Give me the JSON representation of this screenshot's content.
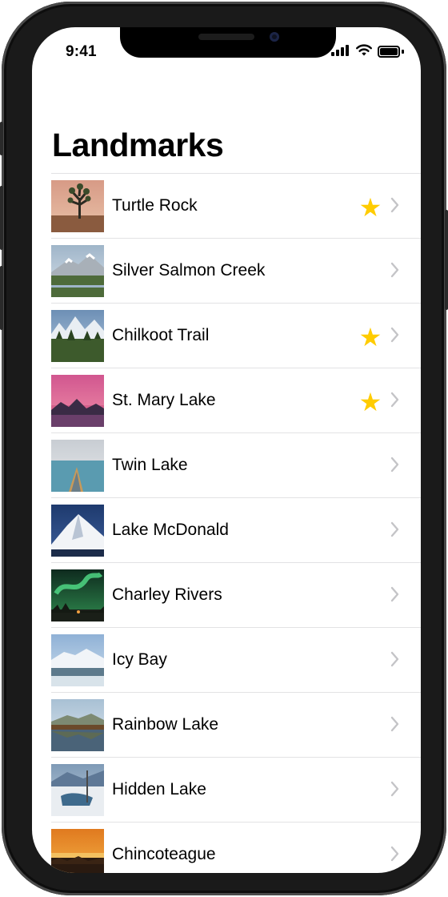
{
  "status_bar": {
    "time": "9:41"
  },
  "nav": {
    "title": "Landmarks"
  },
  "landmarks": [
    {
      "name": "Turtle Rock",
      "favorite": true,
      "thumb": {
        "sky": [
          "#d79a86",
          "#e9c2a8"
        ],
        "ground": "#8a5b3f",
        "feature": "tree"
      }
    },
    {
      "name": "Silver Salmon Creek",
      "favorite": false,
      "thumb": {
        "sky": [
          "#9fb5c9",
          "#d9e2ea"
        ],
        "ground": "#4e6b3a",
        "feature": "mountain"
      }
    },
    {
      "name": "Chilkoot Trail",
      "favorite": true,
      "thumb": {
        "sky": [
          "#6d8fb5",
          "#b5cbe0"
        ],
        "ground": "#3d5a2c",
        "feature": "peaks"
      }
    },
    {
      "name": "St. Mary Lake",
      "favorite": true,
      "thumb": {
        "sky": [
          "#d1568f",
          "#f08fa8"
        ],
        "ground": "#3a2b45",
        "feature": "sunset"
      }
    },
    {
      "name": "Twin Lake",
      "favorite": false,
      "thumb": {
        "sky": [
          "#c8cdd3",
          "#e8eaec"
        ],
        "ground": "#5a9bb0",
        "feature": "canoe"
      }
    },
    {
      "name": "Lake McDonald",
      "favorite": false,
      "thumb": {
        "sky": [
          "#1e3a6e",
          "#3d5e9a"
        ],
        "ground": "#f2f4f7",
        "feature": "snowpeak"
      }
    },
    {
      "name": "Charley Rivers",
      "favorite": false,
      "thumb": {
        "sky": [
          "#0e2a1e",
          "#2f8a4e"
        ],
        "ground": "#1a1f18",
        "feature": "aurora"
      }
    },
    {
      "name": "Icy Bay",
      "favorite": false,
      "thumb": {
        "sky": [
          "#8fb1d6",
          "#d2e1ef"
        ],
        "ground": "#5d7a8c",
        "feature": "glacier"
      }
    },
    {
      "name": "Rainbow Lake",
      "favorite": false,
      "thumb": {
        "sky": [
          "#a8c0d4",
          "#dfe8ef"
        ],
        "ground": "#6b4a2a",
        "feature": "reflection"
      }
    },
    {
      "name": "Hidden Lake",
      "favorite": false,
      "thumb": {
        "sky": [
          "#7e9ab6",
          "#c6d4e2"
        ],
        "ground": "#e9edf1",
        "feature": "snowtree"
      }
    },
    {
      "name": "Chincoteague",
      "favorite": false,
      "thumb": {
        "sky": [
          "#e07a1f",
          "#f6b64a"
        ],
        "ground": "#2a1a10",
        "feature": "dusk"
      }
    }
  ]
}
